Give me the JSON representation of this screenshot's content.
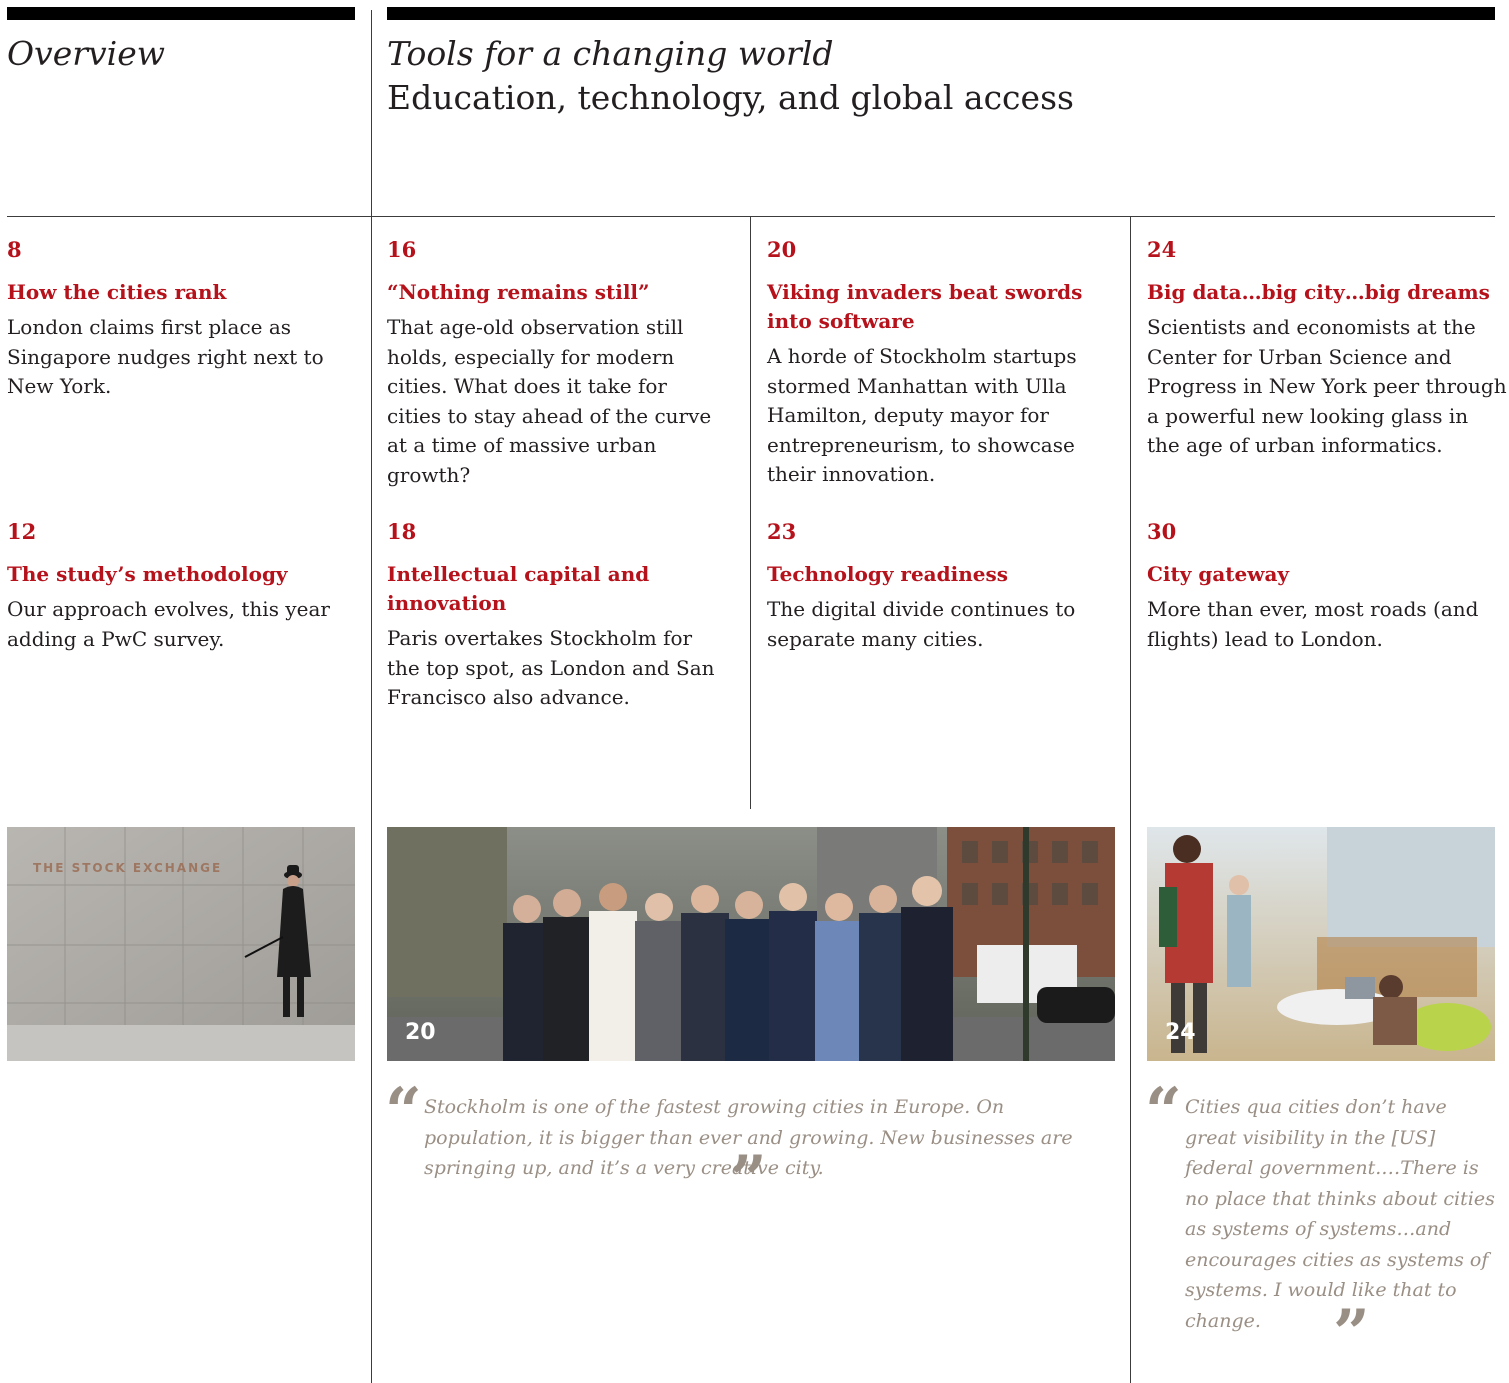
{
  "header": {
    "section_label": "Overview",
    "headline_italic": "Tools for a changing world",
    "headline": "Education, technology, and global access"
  },
  "entries": [
    {
      "page": "8",
      "title": "How the cities rank",
      "desc": "London claims first place as Singapore nudges right next to New York."
    },
    {
      "page": "16",
      "title": "“Nothing remains still”",
      "desc": "That age-old observation still holds, especially for modern cities. What does it take for cities to stay ahead of the curve at a time of massive urban growth?"
    },
    {
      "page": "20",
      "title": "Viking invaders beat swords into software",
      "desc": "A horde of Stockholm startups stormed Manhattan with Ulla Hamilton, deputy mayor for entrepreneurism, to showcase their innovation."
    },
    {
      "page": "24",
      "title": "Big data…big city…big dreams",
      "desc": "Scientists and economists at the Center for Urban Science and Progress in New York peer through a powerful new looking glass in the age of urban informatics."
    },
    {
      "page": "12",
      "title": "The study’s methodology",
      "desc": "Our approach evolves, this year adding a PwC survey."
    },
    {
      "page": "18",
      "title": "Intellectual capital and innovation",
      "desc": "Paris overtakes Stockholm for the top spot, as London and San Francisco also advance."
    },
    {
      "page": "23",
      "title": "Technology readiness",
      "desc": "The digital divide continues to separate many cities."
    },
    {
      "page": "30",
      "title": "City gateway",
      "desc": "More than ever, most roads (and flights) lead to London."
    }
  ],
  "photos": {
    "stock_exchange": {
      "sign": "THE STOCK EXCHANGE"
    },
    "group": {
      "tag": "20"
    },
    "lab": {
      "tag": "24"
    }
  },
  "quotes": {
    "stockholm": "Stockholm is one of the fastest growing cities in Europe. On population, it is bigger than ever and growing. New businesses are springing up, and it’s a very creative city.",
    "cities": "Cities qua cities don’t have great visibility in the [US] federal government.…There is no place that thinks about cities as systems of systems…and encourages cities as systems of systems. I would like that to change."
  },
  "colors": {
    "accent": "#b5121b",
    "quote": "#9a8f85",
    "rule": "#000000"
  }
}
